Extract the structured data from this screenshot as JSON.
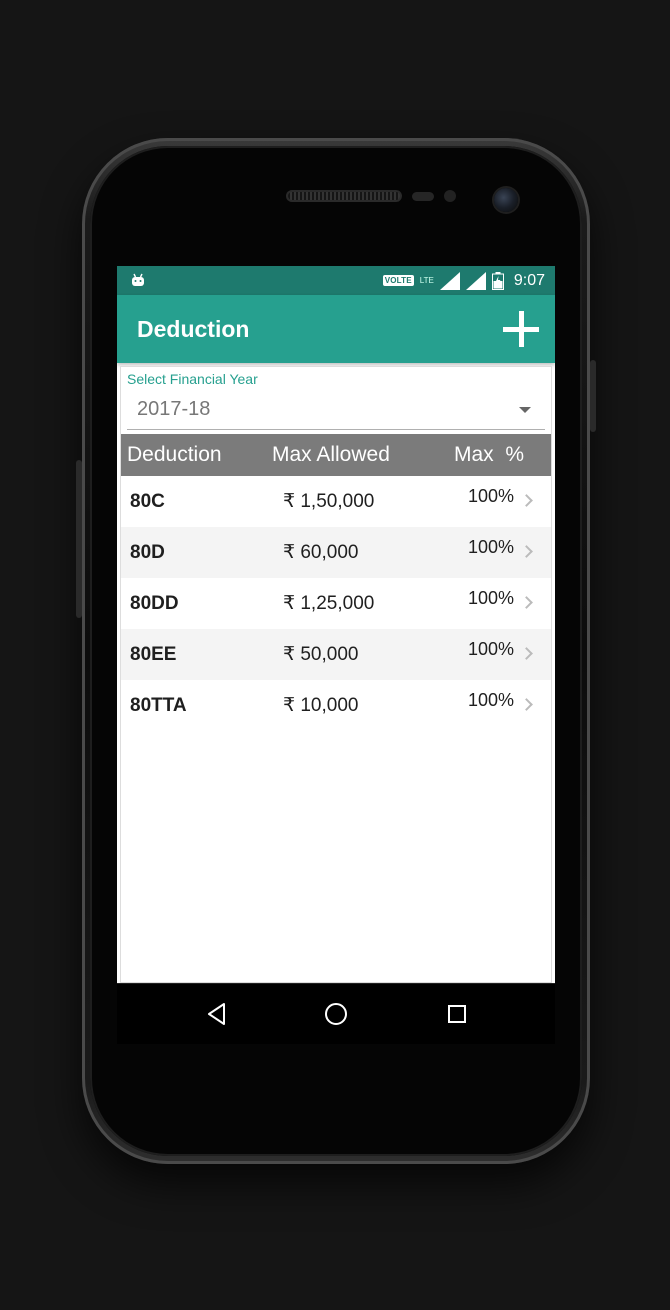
{
  "status_bar": {
    "volte": "VOLTE",
    "lte": "LTE",
    "time": "9:07"
  },
  "app_bar": {
    "title": "Deduction",
    "add_icon": "plus-icon"
  },
  "financial_year": {
    "label": "Select Financial Year",
    "selected": "2017-18"
  },
  "table": {
    "headers": {
      "deduction": "Deduction",
      "max_allowed": "Max Allowed",
      "max_percent": "Max  %"
    },
    "rows": [
      {
        "code": "80C",
        "amount": "₹ 1,50,000",
        "percent": "100%"
      },
      {
        "code": "80D",
        "amount": "₹ 60,000",
        "percent": "100%"
      },
      {
        "code": "80DD",
        "amount": "₹ 1,25,000",
        "percent": "100%"
      },
      {
        "code": "80EE",
        "amount": "₹ 50,000",
        "percent": "100%"
      },
      {
        "code": "80TTA",
        "amount": "₹ 10,000",
        "percent": "100%"
      }
    ]
  },
  "colors": {
    "app_bar": "#26a08f",
    "status_bar": "#1e7a6e",
    "table_header": "#7b7b7b",
    "accent_text": "#26a08f"
  }
}
